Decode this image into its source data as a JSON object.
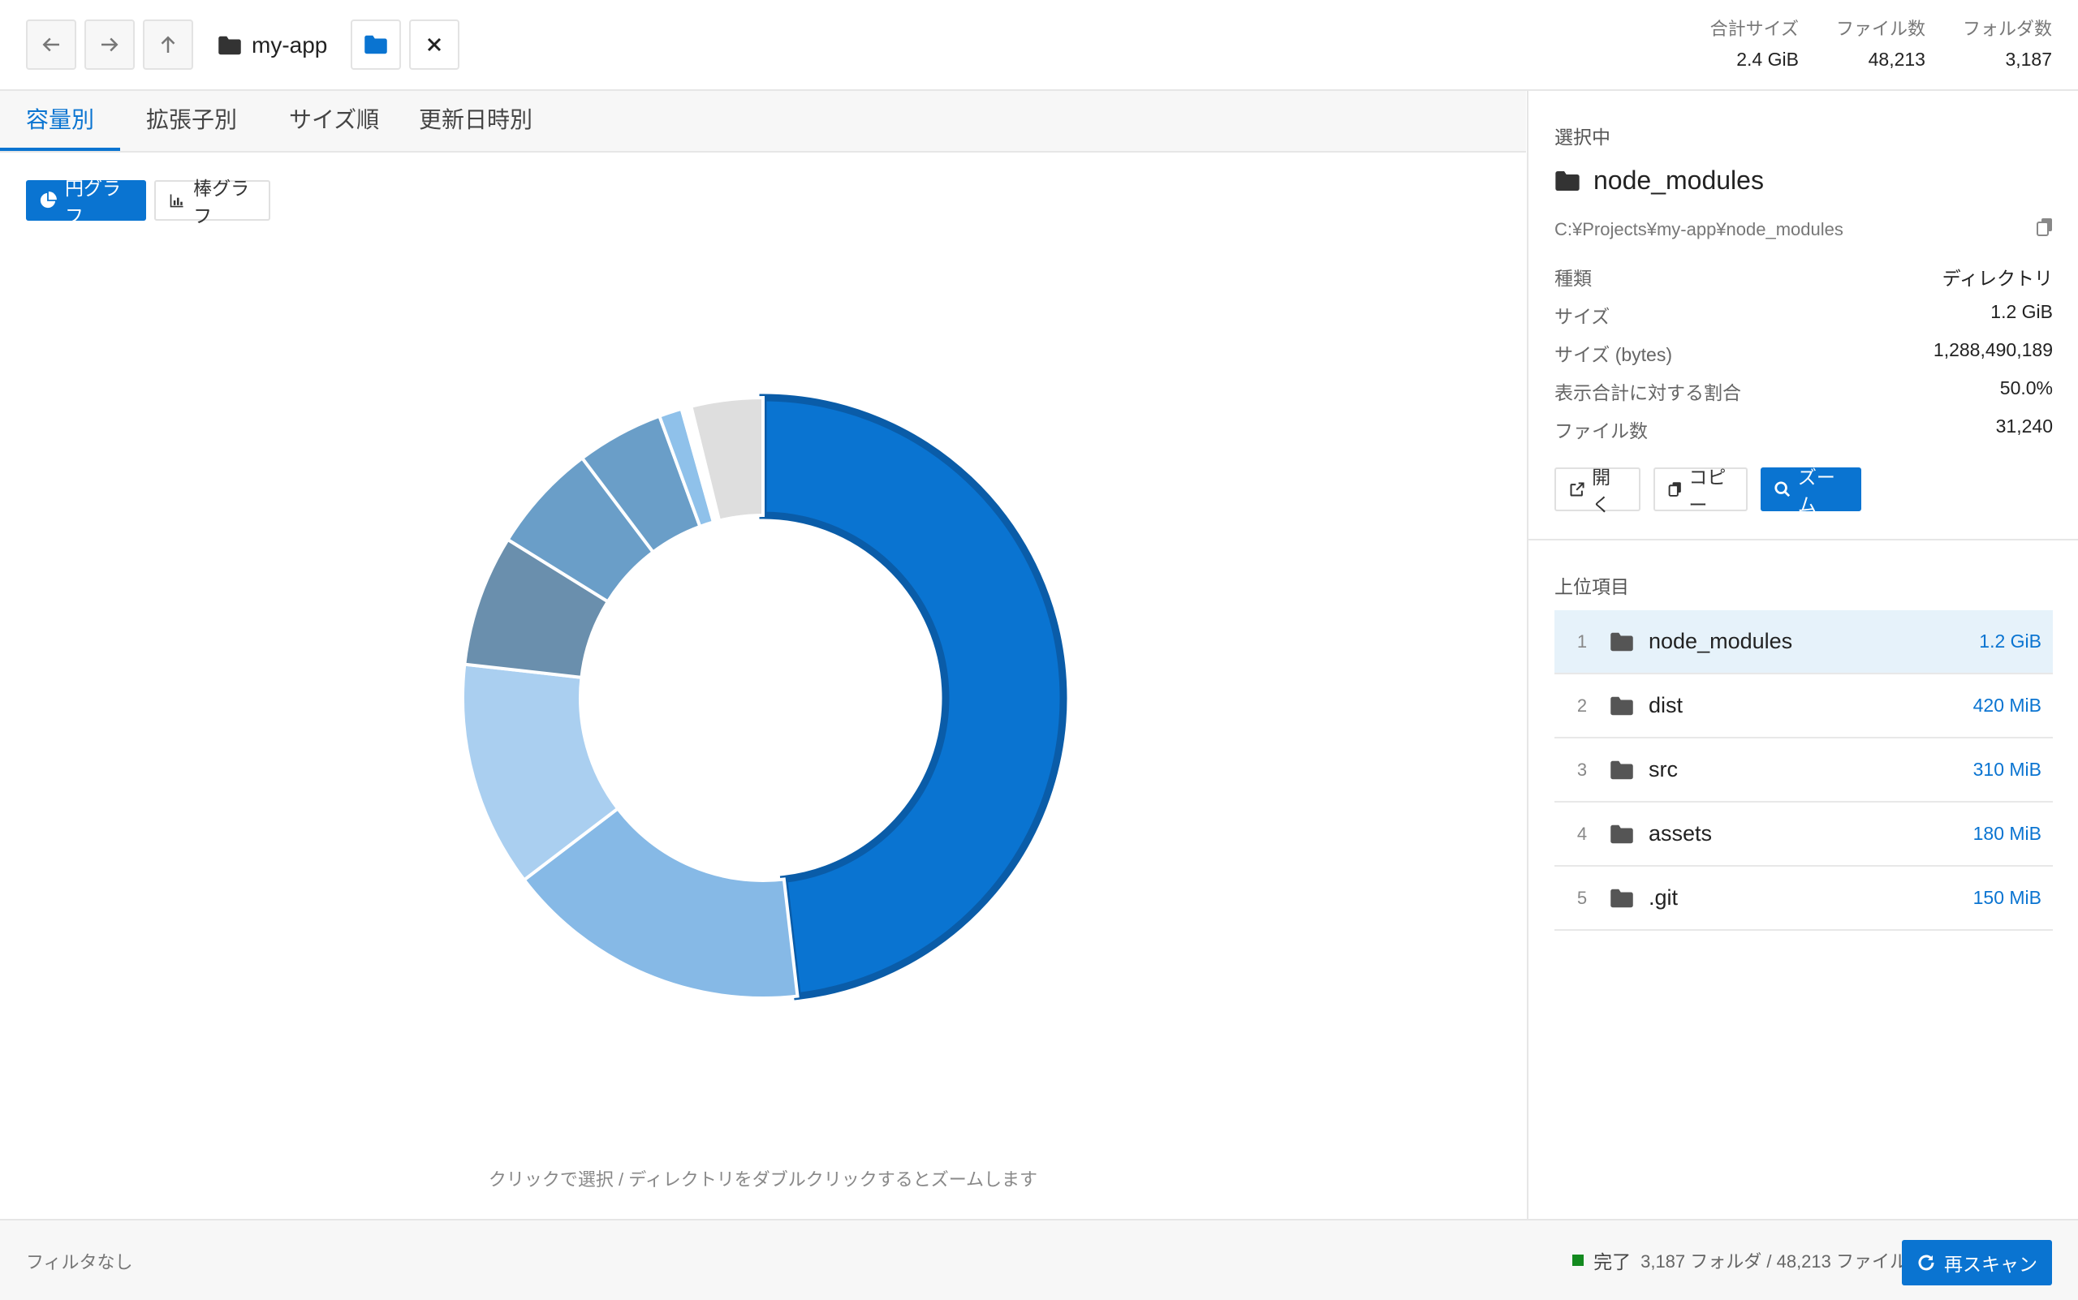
{
  "toolbar": {
    "back_icon": "arrow-left-icon",
    "forward_icon": "arrow-right-icon",
    "up_icon": "arrow-up-icon",
    "path_label": "my-app",
    "open_folder_icon": "folder-icon",
    "close_icon": "close-icon"
  },
  "summary": {
    "total_size_label": "合計サイズ",
    "total_size": "2.4 GiB",
    "files_label": "ファイル数",
    "files": "48,213",
    "folders_label": "フォルダ数",
    "folders": "3,187"
  },
  "tabs": [
    "容量別",
    "拡張子別",
    "サイズ順",
    "更新日時別"
  ],
  "active_tab": 0,
  "view_toggle": {
    "pie_label": "円グラフ",
    "bar_label": "棒グラフ",
    "active": "pie"
  },
  "chart_hint": "クリックで選択 / ディレクトリをダブルクリックするとズームします",
  "chart_data": {
    "type": "pie",
    "style": "donut",
    "selected_index": 0,
    "values": [
      1288490189,
      440401920,
      325058560,
      188743680,
      157286400,
      125000000,
      33000000,
      14000000,
      103000000
    ],
    "colors": [
      "#0a74d1",
      "#86b9e6",
      "#aacff0",
      "#6a8fad",
      "#6a9ec8",
      "#6a9ec8",
      "#8fc1ea",
      "#ffffff",
      "#dedede"
    ],
    "selected_stroke": "#0a5ca8"
  },
  "detail": {
    "section_title": "選択中",
    "name": "node_modules",
    "path": "C:¥Projects¥my-app¥node_modules",
    "copy_icon": "copy-icon",
    "rows": [
      {
        "key": "種類",
        "value": "ディレクトリ"
      },
      {
        "key": "サイズ",
        "value": "1.2 GiB"
      },
      {
        "key": "サイズ (bytes)",
        "value": "1,288,490,189"
      },
      {
        "key": "表示合計に対する割合",
        "value": "50.0%"
      },
      {
        "key": "ファイル数",
        "value": "31,240"
      }
    ],
    "open_label": "開く",
    "copy_label": "コピー",
    "zoom_label": "ズーム"
  },
  "top_items": {
    "title": "上位項目",
    "items": [
      {
        "rank": "1",
        "name": "node_modules",
        "size": "1.2 GiB",
        "selected": true
      },
      {
        "rank": "2",
        "name": "dist",
        "size": "420 MiB"
      },
      {
        "rank": "3",
        "name": "src",
        "size": "310 MiB"
      },
      {
        "rank": "4",
        "name": "assets",
        "size": "180 MiB"
      },
      {
        "rank": "5",
        "name": ".git",
        "size": "150 MiB"
      }
    ]
  },
  "statusbar": {
    "filter_label": "フィルタなし",
    "status_label": "完了",
    "counts": "3,187 フォルダ / 48,213 ファイル",
    "rescan_label": "再スキャン",
    "status_color": "#138a1f"
  }
}
